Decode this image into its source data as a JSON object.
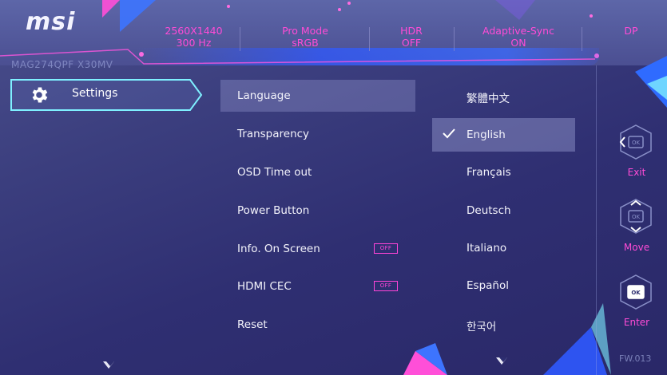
{
  "header": {
    "brand": "msi",
    "model": "MAG274QPF X30MV",
    "stats": [
      {
        "line1": "2560X1440",
        "line2": "300 Hz"
      },
      {
        "line1": "Pro Mode",
        "line2": "sRGB"
      },
      {
        "line1": "HDR",
        "line2": "OFF"
      },
      {
        "line1": "Adaptive-Sync",
        "line2": "ON"
      },
      {
        "line1": "DP",
        "line2": ""
      }
    ]
  },
  "sidebar": {
    "active_label": "Settings",
    "icon": "gear-icon"
  },
  "menu": {
    "items": [
      {
        "label": "Language"
      },
      {
        "label": "Transparency"
      },
      {
        "label": "OSD Time out"
      },
      {
        "label": "Power Button"
      },
      {
        "label": "Info. On Screen",
        "toggle": "OFF"
      },
      {
        "label": "HDMI CEC",
        "toggle": "OFF"
      },
      {
        "label": "Reset"
      }
    ],
    "selected_index": 0
  },
  "languages": {
    "items": [
      "繁體中文",
      "English",
      "Français",
      "Deutsch",
      "Italiano",
      "Español",
      "한국어"
    ],
    "selected_index": 1
  },
  "controls": [
    {
      "label": "Exit",
      "icon": "ok-exit-icon"
    },
    {
      "label": "Move",
      "icon": "ok-move-icon"
    },
    {
      "label": "Enter",
      "icon": "ok-enter-icon"
    }
  ],
  "footer": {
    "firmware": "FW.013"
  },
  "colors": {
    "accent_pink": "#ff4bd6",
    "accent_cyan": "#7ff0ff",
    "blue_sweep": "#2f59ff"
  }
}
